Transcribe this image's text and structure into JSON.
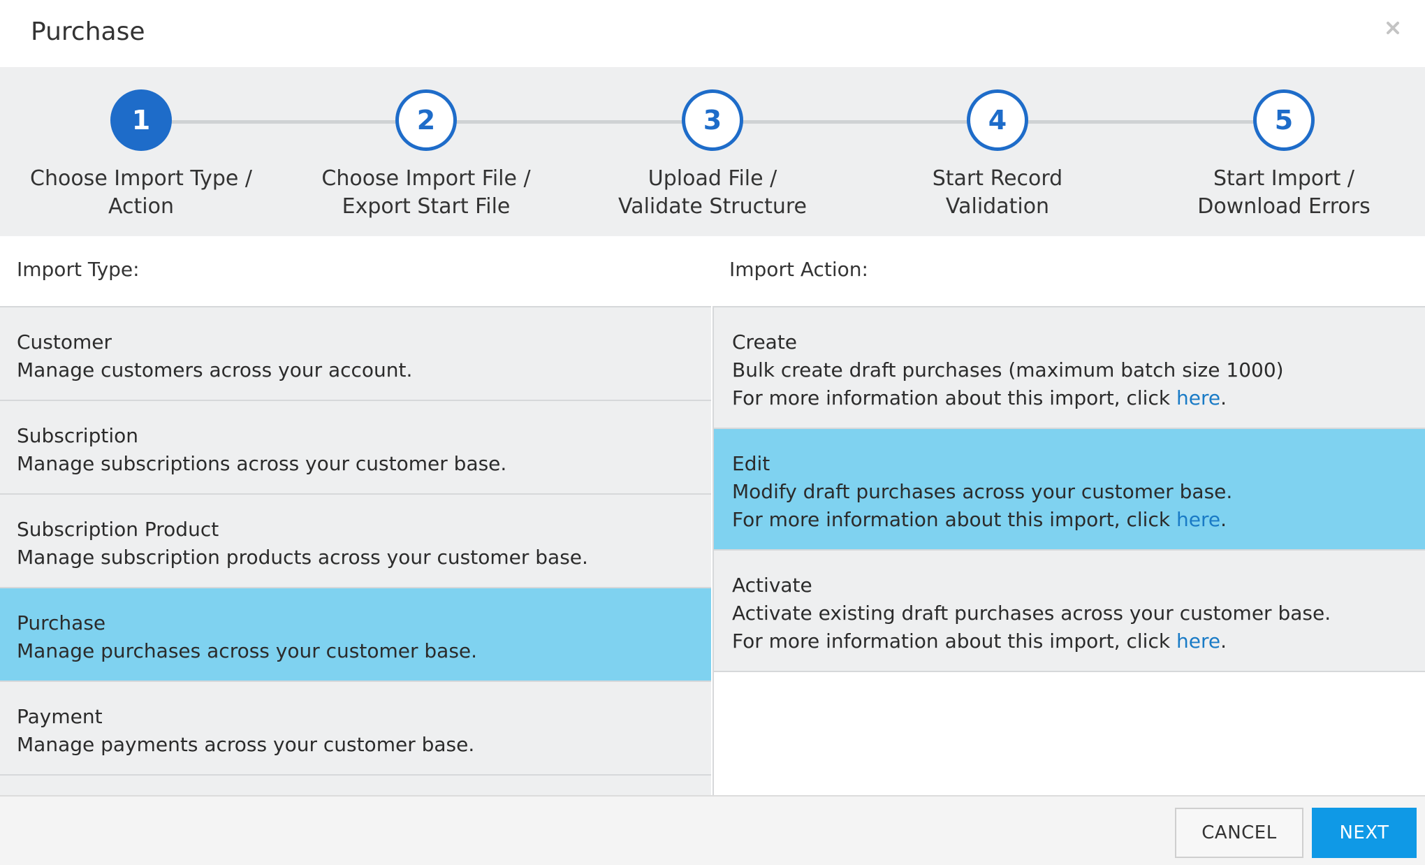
{
  "header": {
    "title": "Purchase",
    "close_icon": "close-icon"
  },
  "stepper": {
    "steps": [
      {
        "number": "1",
        "label_line1": "Choose Import Type /",
        "label_line2": "Action",
        "active": true
      },
      {
        "number": "2",
        "label_line1": "Choose Import File /",
        "label_line2": "Export Start File",
        "active": false
      },
      {
        "number": "3",
        "label_line1": "Upload File /",
        "label_line2": "Validate Structure",
        "active": false
      },
      {
        "number": "4",
        "label_line1": "Start Record",
        "label_line2": "Validation",
        "active": false
      },
      {
        "number": "5",
        "label_line1": "Start Import /",
        "label_line2": "Download Errors",
        "active": false
      }
    ]
  },
  "import_type": {
    "heading": "Import Type:",
    "items": [
      {
        "title": "Customer",
        "desc": "Manage customers across your account.",
        "selected": false
      },
      {
        "title": "Subscription",
        "desc": "Manage subscriptions across your customer base.",
        "selected": false
      },
      {
        "title": "Subscription Product",
        "desc": "Manage subscription products across your customer base.",
        "selected": false
      },
      {
        "title": "Purchase",
        "desc": "Manage purchases across your customer base.",
        "selected": true
      },
      {
        "title": "Payment",
        "desc": "Manage payments across your customer base.",
        "selected": false
      }
    ]
  },
  "import_action": {
    "heading": "Import Action:",
    "info_prefix": "For more information about this import, click ",
    "info_link": "here",
    "info_suffix": ".",
    "items": [
      {
        "title": "Create",
        "desc": "Bulk create draft purchases (maximum batch size 1000)",
        "selected": false
      },
      {
        "title": "Edit",
        "desc": "Modify draft purchases across your customer base.",
        "selected": true
      },
      {
        "title": "Activate",
        "desc": "Activate existing draft purchases across your customer base.",
        "selected": false
      }
    ]
  },
  "footer": {
    "cancel_label": "CANCEL",
    "next_label": "NEXT"
  },
  "colors": {
    "accent": "#1e6cc9",
    "selected": "#7fd2f0",
    "next_button": "#0f99e6",
    "link": "#1a7bc6"
  }
}
